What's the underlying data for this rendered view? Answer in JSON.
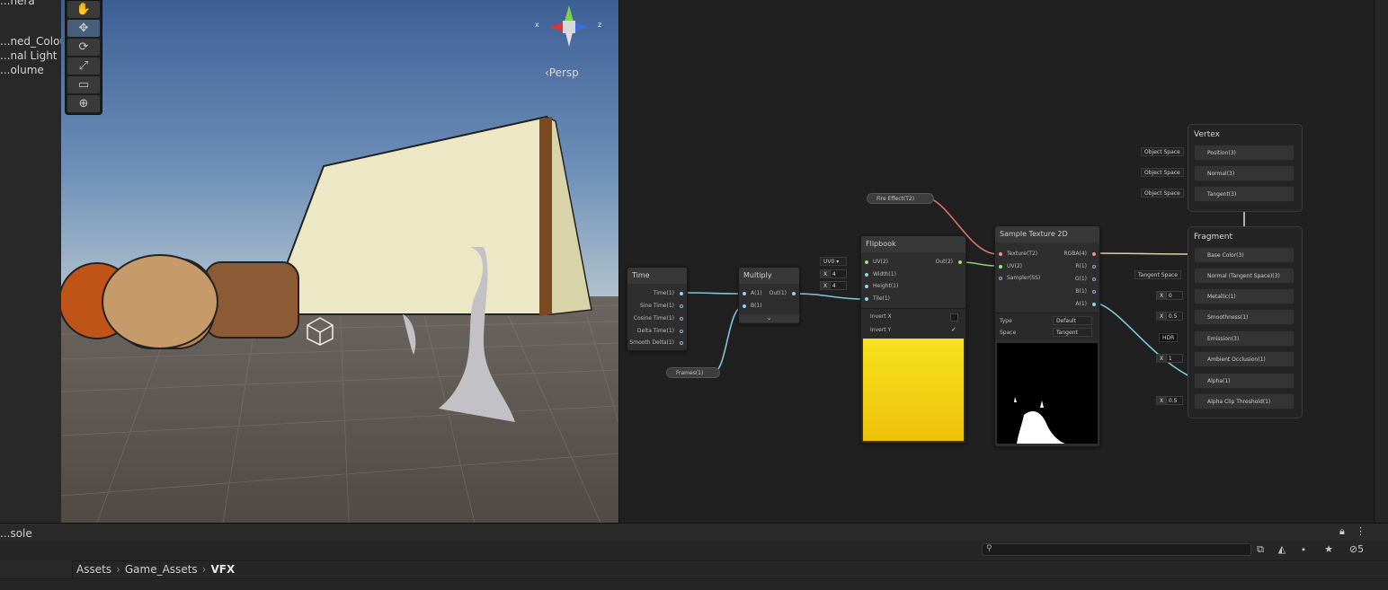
{
  "hierarchy": {
    "items": [
      "...ned_ColourPa",
      "...nal Light",
      "...olume"
    ],
    "top_partial": "...nera"
  },
  "scene": {
    "gizmo": {
      "x_label": "x",
      "z_label": "z"
    },
    "projection_label": "‹Persp",
    "tools": [
      "hand-tool",
      "move-tool",
      "rotate-tool",
      "scale-tool",
      "rect-tool",
      "transform-tool"
    ]
  },
  "graph": {
    "time_node": {
      "title": "Time",
      "ports": [
        "Time(1)",
        "Sine Time(1)",
        "Cosine Time(1)",
        "Delta Time(1)",
        "Smooth Delta(1)"
      ]
    },
    "multiply_node": {
      "title": "Multiply",
      "inputs": [
        "A(1)",
        "B(1)"
      ],
      "output": "Out(1)"
    },
    "frames_property": "Frames(1)",
    "fire_property": "Fire Effect(T2)",
    "flipbook_node": {
      "title": "Flipbook",
      "inputs": [
        "UV(2)",
        "Width(1)",
        "Height(1)",
        "Tile(1)"
      ],
      "output": "Out(2)",
      "uv_value": "UV0",
      "width_value": "4",
      "height_value": "4",
      "invert_x": "Invert X",
      "invert_y": "Invert Y"
    },
    "sample_node": {
      "title": "Sample Texture 2D",
      "inputs": [
        "Texture(T2)",
        "UV(2)",
        "Sampler(SS)"
      ],
      "outputs": [
        "RGBA(4)",
        "R(1)",
        "G(1)",
        "B(1)",
        "A(1)"
      ],
      "type_label": "Type",
      "type_value": "Default",
      "space_label": "Space",
      "space_value": "Tangent"
    },
    "vertex": {
      "title": "Vertex",
      "slots": [
        "Position(3)",
        "Normal(3)",
        "Tangent(3)"
      ],
      "chips": [
        "Object Space",
        "Object Space",
        "Object Space"
      ]
    },
    "fragment": {
      "title": "Fragment",
      "slots": [
        "Base Color(3)",
        "Normal (Tangent Space)(3)",
        "Metallic(1)",
        "Smoothness(1)",
        "Emission(3)",
        "Ambient Occlusion(1)",
        "Alpha(1)",
        "Alpha Clip Threshold(1)"
      ],
      "tangent_chip": "Tangent Space",
      "metallic": "0",
      "smoothness": "0.5",
      "emission_chip": "HDR",
      "ao": "1",
      "alpha_clip": "0.5",
      "x_label": "X"
    }
  },
  "console": {
    "tab_label": "...sole"
  },
  "project": {
    "breadcrumb": [
      "Assets",
      "Game_Assets",
      "VFX"
    ],
    "hidden_count": "5"
  },
  "colors": {
    "accent_blue": "#46607c",
    "wire_blue": "#7fc6d9",
    "wire_pink": "#d9736e",
    "wire_green": "#8fd36f",
    "flipbook_yellow": "#f1cf10"
  }
}
